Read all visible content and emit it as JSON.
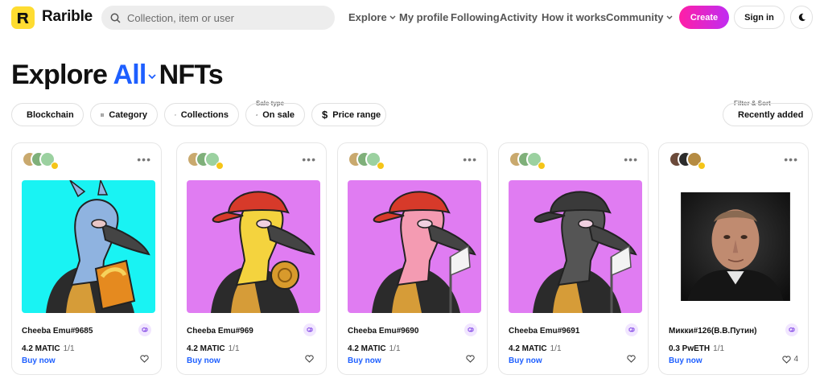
{
  "header": {
    "logo_text": "Rarible",
    "search_placeholder": "Collection, item or user",
    "nav": [
      {
        "label": "Explore",
        "dropdown": true
      },
      {
        "label": "My profile",
        "dropdown": false
      },
      {
        "label": "Following",
        "dropdown": false
      },
      {
        "label": "Activity",
        "dropdown": false
      },
      {
        "label": "How it works",
        "dropdown": false
      },
      {
        "label": "Community",
        "dropdown": true
      }
    ],
    "create_label": "Create",
    "signin_label": "Sign in",
    "theme_icon": "moon-icon"
  },
  "title": {
    "prefix": "Explore",
    "accent": "All",
    "suffix": "NFTs"
  },
  "filters": {
    "blockchain": "Blockchain",
    "category": "Category",
    "collections": "Collections",
    "sale_type_caption": "Sale type",
    "sale_type": "On sale",
    "price_range": "Price range",
    "sort_caption": "Filter & Sort",
    "sort": "Recently added"
  },
  "cards": [
    {
      "name": "Cheeba Emu#9685",
      "price": "4.2 MATIC",
      "quantity": "1/1",
      "action": "Buy now",
      "likes": "",
      "art": "blue-emu"
    },
    {
      "name": "Cheeba Emu#969",
      "price": "4.2 MATIC",
      "quantity": "1/1",
      "action": "Buy now",
      "likes": "",
      "art": "yellow-emu"
    },
    {
      "name": "Cheeba Emu#9690",
      "price": "4.2 MATIC",
      "quantity": "1/1",
      "action": "Buy now",
      "likes": "",
      "art": "pink-emu"
    },
    {
      "name": "Cheeba Emu#9691",
      "price": "4.2 MATIC",
      "quantity": "1/1",
      "action": "Buy now",
      "likes": "",
      "art": "dark-emu"
    },
    {
      "name": "Микки#126(В.В.Путин)",
      "price": "0.3 PwETH",
      "quantity": "1/1",
      "action": "Buy now",
      "likes": "4",
      "art": "portrait"
    }
  ],
  "colors": {
    "accent": "#1e5fff",
    "logo": "#fedc31",
    "create_gradient_start": "#ff1fa6",
    "create_gradient_end": "#c02cf2"
  }
}
